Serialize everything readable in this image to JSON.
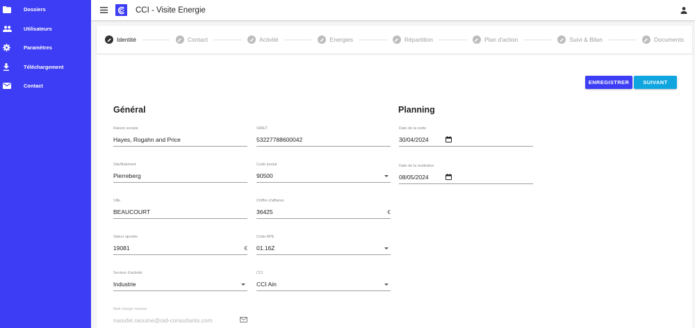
{
  "sidebar": {
    "items": [
      {
        "label": "Dossiers",
        "icon": "folder-icon"
      },
      {
        "label": "Utilisateurs",
        "icon": "users-icon"
      },
      {
        "label": "Paramètres",
        "icon": "gear-icon"
      },
      {
        "label": "Téléchargement",
        "icon": "download-icon"
      },
      {
        "label": "Contact",
        "icon": "mail-icon"
      }
    ]
  },
  "header": {
    "title": "CCI - Visite Energie"
  },
  "stepper": {
    "steps": [
      {
        "label": "Identité",
        "active": true
      },
      {
        "label": "Contact"
      },
      {
        "label": "Activité"
      },
      {
        "label": "Energies"
      },
      {
        "label": "Répartition"
      },
      {
        "label": "Plan d'action"
      },
      {
        "label": "Suivi & Bilan"
      },
      {
        "label": "Documents"
      }
    ]
  },
  "actions": {
    "save_label": "ENREGISTRER",
    "next_label": "SUIVANT"
  },
  "general": {
    "title": "Général",
    "raison_sociale": {
      "label": "Raison sociale",
      "value": "Hayes, Rogahn and Price"
    },
    "siret": {
      "label": "SIRET",
      "value": "53227788600042"
    },
    "site": {
      "label": "Site/Batiment",
      "value": "Pierreberg"
    },
    "code_postal": {
      "label": "Code postal",
      "value": "90500"
    },
    "ville": {
      "label": "Ville",
      "value": "BEAUCOURT"
    },
    "chiffre_affaires": {
      "label": "Chiffre d'affaires",
      "value": "36425",
      "suffix": "€"
    },
    "valeur_ajoutee": {
      "label": "Valeur ajoutée",
      "value": "19081",
      "suffix": "€"
    },
    "code_ape": {
      "label": "Code APE",
      "value": "01.16Z"
    },
    "secteur": {
      "label": "Secteur d'activité",
      "value": "Industrie"
    },
    "cci": {
      "label": "CCI",
      "value": "CCI Ain"
    },
    "mail": {
      "label": "Mail chargé mission",
      "value": "naoufel.raouine@oid-consultants.com"
    }
  },
  "planning": {
    "title": "Planning",
    "date_visite": {
      "label": "Date de la visite",
      "value": "30/04/2024"
    },
    "date_restitution": {
      "label": "Date de la restitution",
      "value": "08/05/2024"
    }
  },
  "colors": {
    "brand": "#3d3df5",
    "secondary": "#0fa6e0"
  }
}
